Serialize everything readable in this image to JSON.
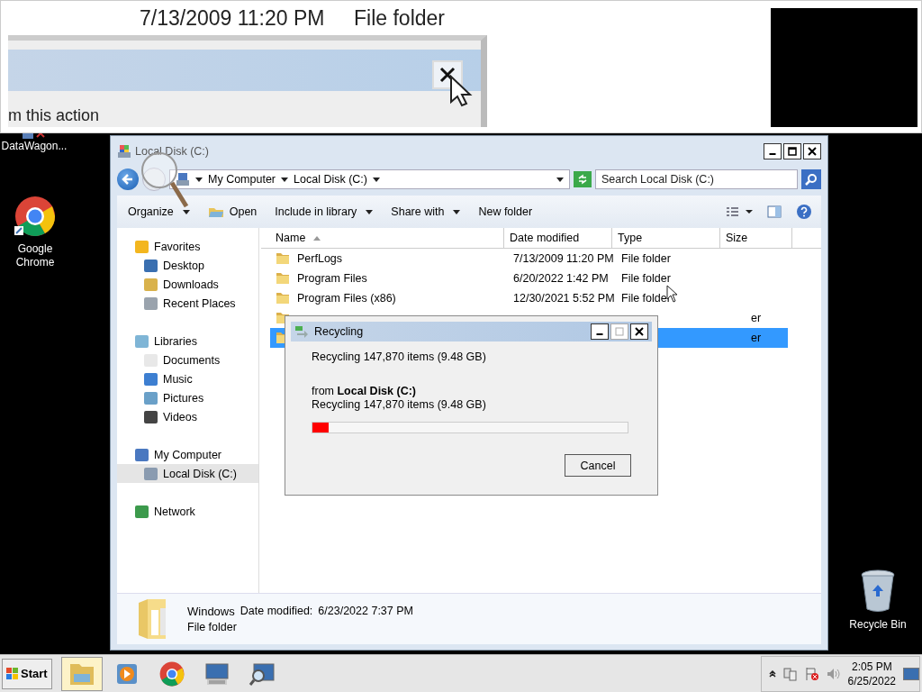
{
  "zoom_panel": {
    "date": "7/13/2009 11:20 PM",
    "type": "File folder",
    "dialog_text": "m this action"
  },
  "desktop_icons": [
    {
      "kind": "app",
      "label": "DataWagon..."
    },
    {
      "kind": "chrome",
      "label": "Google Chrome"
    },
    {
      "kind": "recycle",
      "label": "Recycle Bin"
    }
  ],
  "explorer": {
    "title": "Local Disk (C:)",
    "breadcrumb": [
      "My Computer",
      "Local Disk (C:)"
    ],
    "search": {
      "placeholder": "Search Local Disk (C:)"
    },
    "toolbar": [
      {
        "kind": "menu",
        "label": "Organize"
      },
      {
        "kind": "open",
        "label": "Open"
      },
      {
        "kind": "menu",
        "label": "Include in library"
      },
      {
        "kind": "menu",
        "label": "Share with"
      },
      {
        "kind": "plain",
        "label": "New folder"
      }
    ],
    "nav": [
      {
        "kind": "star",
        "label": "Favorites",
        "selected": false,
        "children": [
          {
            "kind": "desktop",
            "label": "Desktop",
            "selected": false
          },
          {
            "kind": "downloads",
            "label": "Downloads",
            "selected": false
          },
          {
            "kind": "recent",
            "label": "Recent Places",
            "selected": false
          }
        ]
      },
      {
        "kind": "library",
        "label": "Libraries",
        "selected": false,
        "children": [
          {
            "kind": "document",
            "label": "Documents",
            "selected": false
          },
          {
            "kind": "music",
            "label": "Music",
            "selected": false
          },
          {
            "kind": "picture",
            "label": "Pictures",
            "selected": false
          },
          {
            "kind": "video",
            "label": "Videos",
            "selected": false
          }
        ]
      },
      {
        "kind": "computer",
        "label": "My Computer",
        "selected": false,
        "children": [
          {
            "kind": "disk",
            "label": "Local Disk (C:)",
            "selected": true
          }
        ]
      },
      {
        "kind": "network",
        "label": "Network",
        "selected": false
      }
    ],
    "columns": [
      {
        "label": "Name",
        "sorted": true
      },
      {
        "label": "Date modified",
        "sorted": false
      },
      {
        "label": "Type",
        "sorted": false
      },
      {
        "label": "Size",
        "sorted": false
      }
    ],
    "rows": [
      {
        "name": "PerfLogs",
        "date": "7/13/2009 11:20 PM",
        "type": "File folder",
        "selected": false
      },
      {
        "name": "Program Files",
        "date": "6/20/2022 1:42 PM",
        "type": "File folder",
        "selected": false
      },
      {
        "name": "Program Files (x86)",
        "date": "12/30/2021 5:52 PM",
        "type": "File folder",
        "selected": false
      },
      {
        "type_fragment": "er",
        "selected": false
      },
      {
        "type_fragment": "er",
        "selected": true
      }
    ],
    "details": {
      "name": "Windows",
      "meta_label": "Date modified:",
      "meta_value": "6/23/2022 7:37 PM",
      "type": "File folder"
    }
  },
  "dialog": {
    "title": "Recycling",
    "status": "Recycling 147,870 items (9.48 GB)",
    "from": "from **Local Disk (C:)**",
    "detail": "Recycling 147,870 items (9.48 GB)",
    "level": 0.05,
    "button": "Cancel"
  },
  "taskbar": {
    "start": "Start",
    "apps": [
      {
        "kind": "explorer",
        "selected": true
      },
      {
        "kind": "media",
        "selected": false
      },
      {
        "kind": "chrome",
        "selected": false
      },
      {
        "kind": "remote",
        "selected": false
      },
      {
        "kind": "magnifier",
        "selected": false
      }
    ],
    "time": "2:05 PM",
    "date": "6/25/2022"
  }
}
